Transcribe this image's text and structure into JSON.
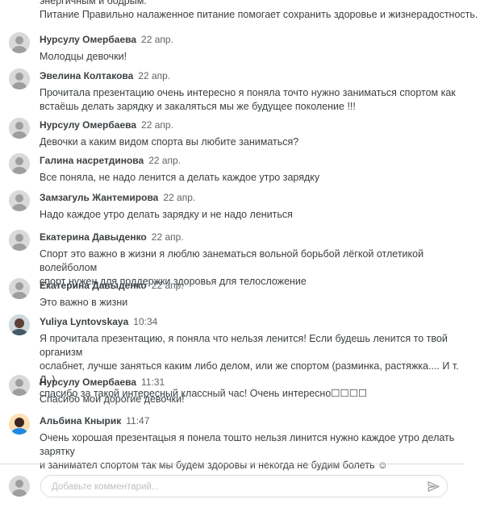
{
  "top_text": [
    "энергичным и бодрым.",
    "Питание  Правильно налаженное питание помогает сохранить здоровье и жизнерадостность."
  ],
  "comments": [
    {
      "author": "Нурсулу Омербаева",
      "time": "22 апр.",
      "avatar": "default",
      "lines": [
        "Молодцы девочки!"
      ]
    },
    {
      "author": "Эвелина Колтакова",
      "time": "22 апр.",
      "avatar": "default",
      "lines": [
        "Прочитала презентацию очень интересно я поняла точто нужно заниматься спортом как",
        "встаёшь делать зарядку и закаляться мы же будущее поколение !!!"
      ]
    },
    {
      "author": "Нурсулу Омербаева",
      "time": "22 апр.",
      "avatar": "default",
      "lines": [
        "Девочки а каким видом спорта вы любите заниматься?"
      ]
    },
    {
      "author": "Галина насретдинова",
      "time": "22 апр.",
      "avatar": "default",
      "lines": [
        "Все поняла, не надо ленится а делать каждое утро зарядку"
      ]
    },
    {
      "author": "Замзагуль Жантемирова",
      "time": "22 апр.",
      "avatar": "default",
      "lines": [
        "Надо каждое утро делать зарядку и не надо лениться"
      ]
    },
    {
      "author": "Екатерина Давыденко",
      "time": "22 апр.",
      "avatar": "default",
      "lines": [
        "Спорт это важно в жизни я люблю занематься вольной борьбой лёгкой отлетикой волейболом",
        "спорт нужен для поддержки здоровья для телосложение"
      ]
    },
    {
      "author": "Екатерина Давыденко",
      "time": "22 апр.",
      "avatar": "default",
      "lines": [
        "Это важно в жизни"
      ]
    },
    {
      "author": "Yuliya Lyntovskaya",
      "time": "10:34",
      "avatar": "photo-1",
      "lines": [
        "Я прочитала презентацию, я поняла что нельзя ленится! Если будешь ленится то твой организм",
        "ослабнет, лучше заняться каким либо делом, или же спортом (разминка, растяжка.... И т. Д. )",
        "спасибо за такой интересный классный час! Очень интересно☐☐☐☐"
      ]
    },
    {
      "author": "Нурсулу Омербаева",
      "time": "11:31",
      "avatar": "default",
      "lines": [
        "Спасибо мои дорогие девочки!"
      ]
    },
    {
      "author": "Альбина Кнырик",
      "time": "11:47",
      "avatar": "photo-2",
      "lines": [
        "Очень хорошая презентацыя я понела тошто нельзя линится нужно каждое утро делать зарятку",
        "и занимател спортом так мы будем здоровы и некогда не будим болеть ☺"
      ]
    }
  ],
  "composer": {
    "placeholder": "Добавьте комментарий..."
  },
  "icons": {
    "avatar": "person-icon",
    "send": "send-icon"
  },
  "colors": {
    "avatar_bg": "#d9d9d9",
    "avatar_fg": "#9e9e9e",
    "send": "#9aa0a6"
  }
}
